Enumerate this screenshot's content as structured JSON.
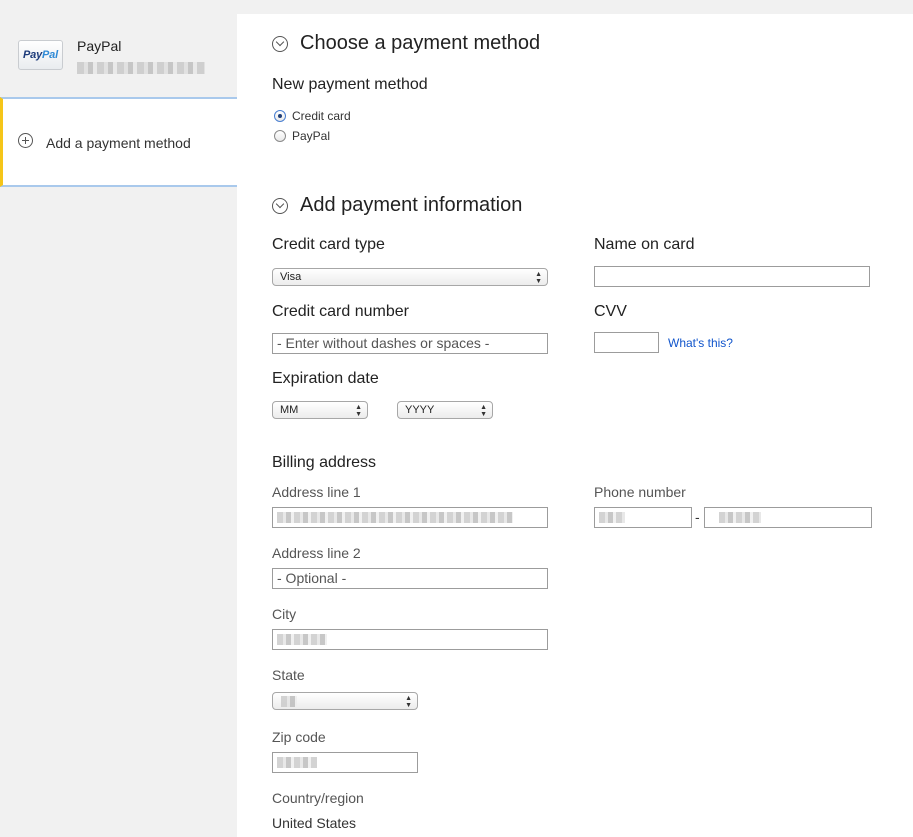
{
  "sidebar": {
    "paypal_logo_text_a": "Pay",
    "paypal_logo_text_b": "Pal",
    "paypal_name": "PayPal",
    "add_method_label": "Add a payment method"
  },
  "colors": {
    "accent_selected_border": "#f5c518",
    "selected_highlight": "#a9c9ec",
    "link": "#1155cc"
  },
  "sections": {
    "choose": {
      "title": "Choose a payment method",
      "new_method_label": "New payment method",
      "options": [
        {
          "label": "Credit card",
          "checked": true
        },
        {
          "label": "PayPal",
          "checked": false
        }
      ]
    },
    "add_info": {
      "title": "Add payment information",
      "card_type_label": "Credit card type",
      "card_type_value": "Visa",
      "name_on_card_label": "Name on card",
      "card_number_label": "Credit card number",
      "card_number_placeholder": "- Enter without dashes or spaces -",
      "cvv_label": "CVV",
      "cvv_help_link": "What's this?",
      "expiration_label": "Expiration date",
      "exp_month_value": "MM",
      "exp_year_value": "YYYY"
    },
    "billing": {
      "title": "Billing address",
      "address1_label": "Address line 1",
      "phone_label": "Phone number",
      "phone_separator": "-",
      "address2_label": "Address line 2",
      "address2_placeholder": "- Optional -",
      "city_label": "City",
      "state_label": "State",
      "zip_label": "Zip code",
      "country_label": "Country/region",
      "country_value": "United States"
    }
  }
}
